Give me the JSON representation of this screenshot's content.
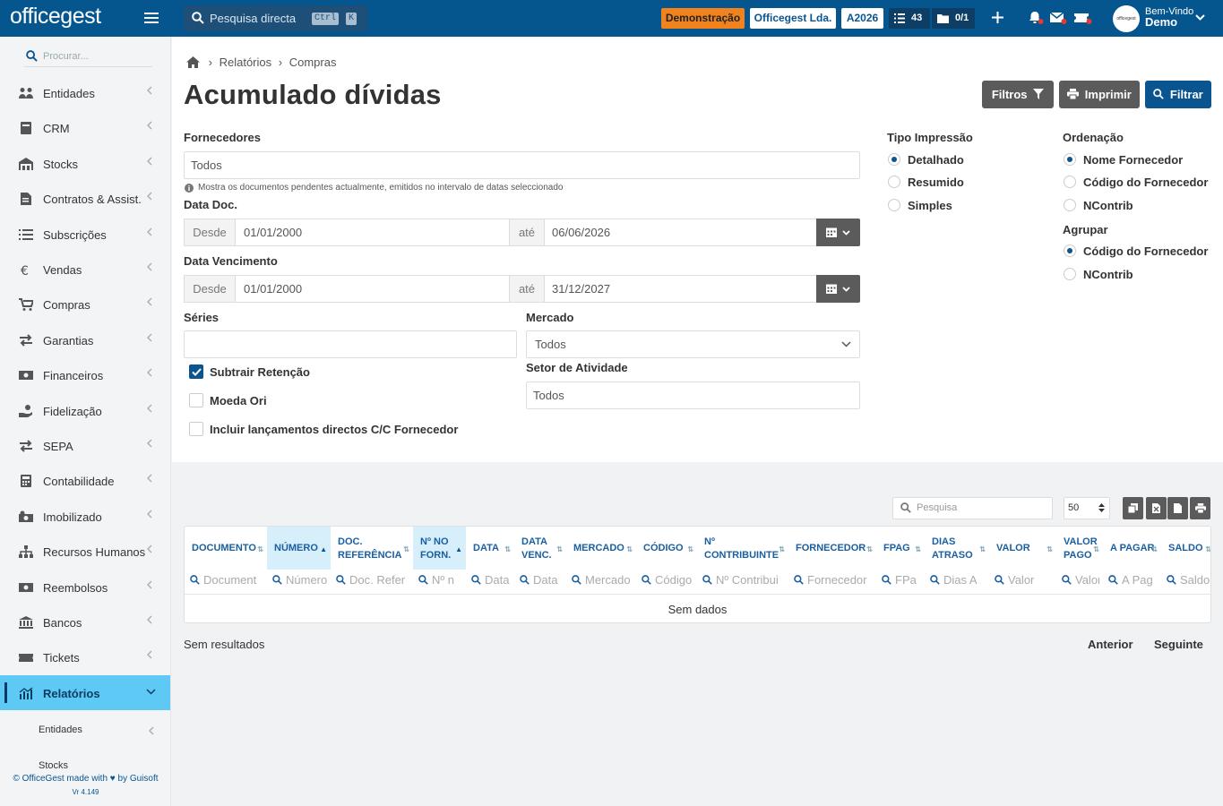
{
  "topbar": {
    "logo": "officegest",
    "search_placeholder": "Pesquisa directa",
    "kbd1": "Ctrl",
    "kbd2": "K",
    "demo": "Demonstração",
    "company": "Officegest Lda.",
    "year": "A2026",
    "tasks": "43",
    "docs": "0/1",
    "welcome": "Bem-Vindo",
    "user": "Demo",
    "avatar_text": "officegest"
  },
  "sidebar": {
    "search_placeholder": "Procurar...",
    "items": [
      {
        "label": "Entidades",
        "icon": "users-icon"
      },
      {
        "label": "CRM",
        "icon": "book-icon"
      },
      {
        "label": "Stocks",
        "icon": "warehouse-icon"
      },
      {
        "label": "Contratos & Assist.",
        "icon": "file-contract-icon"
      },
      {
        "label": "Subscrições",
        "icon": "list-icon"
      },
      {
        "label": "Vendas",
        "icon": "euro-icon"
      },
      {
        "label": "Compras",
        "icon": "cart-icon"
      },
      {
        "label": "Garantias",
        "icon": "exchange-icon"
      },
      {
        "label": "Financeiros",
        "icon": "money-icon"
      },
      {
        "label": "Fidelização",
        "icon": "hand-coin-icon"
      },
      {
        "label": "SEPA",
        "icon": "exchange-icon"
      },
      {
        "label": "Contabilidade",
        "icon": "calculator-icon"
      },
      {
        "label": "Imobilizado",
        "icon": "cogs-money-icon"
      },
      {
        "label": "Recursos Humanos",
        "icon": "sitemap-icon"
      },
      {
        "label": "Reembolsos",
        "icon": "money-icon"
      },
      {
        "label": "Bancos",
        "icon": "bank-icon"
      },
      {
        "label": "Tickets",
        "icon": "ticket-icon"
      },
      {
        "label": "Relatórios",
        "icon": "chart-icon"
      }
    ],
    "sub": [
      "Entidades",
      "Stocks"
    ],
    "footer": "© OfficeGest made with ♥ by Guisoft",
    "version": "Vr 4.149"
  },
  "breadcrumb": [
    "Relatórios",
    "Compras"
  ],
  "title": "Acumulado dívidas",
  "buttons": {
    "filtros": "Filtros",
    "imprimir": "Imprimir",
    "filtrar": "Filtrar"
  },
  "form": {
    "fornecedores_label": "Fornecedores",
    "fornecedores_value": "Todos",
    "hint": "Mostra os documentos pendentes actualmente, emitidos no intervalo de datas seleccionado",
    "data_doc_label": "Data Doc.",
    "desde": "Desde",
    "ate": "até",
    "data_doc_from": "01/01/2000",
    "data_doc_to": "06/06/2026",
    "data_venc_label": "Data Vencimento",
    "data_venc_from": "01/01/2000",
    "data_venc_to": "31/12/2027",
    "series_label": "Séries",
    "mercado_label": "Mercado",
    "mercado_value": "Todos",
    "setor_label": "Setor de Atividade",
    "setor_value": "Todos",
    "chk_subtrair": "Subtrair Retenção",
    "chk_moeda": "Moeda Ori",
    "chk_incluir": "Incluir lançamentos directos C/C Fornecedor",
    "tipo_label": "Tipo Impressão",
    "tipo_options": [
      "Detalhado",
      "Resumido",
      "Simples"
    ],
    "ordem_label": "Ordenação",
    "ordem_options": [
      "Nome Fornecedor",
      "Código do Fornecedor",
      "NContrib"
    ],
    "agrupar_label": "Agrupar",
    "agrupar_options": [
      "Código do Fornecedor",
      "NContrib"
    ]
  },
  "grid": {
    "search_placeholder": "Pesquisa",
    "page_size": "50",
    "columns": [
      {
        "h1": "DOCUMENTO",
        "h2": "",
        "f": "Document"
      },
      {
        "h1": "NÚMERO",
        "h2": "",
        "f": "Número"
      },
      {
        "h1": "DOC.",
        "h2": "REFERÊNCIA",
        "f": "Doc. Refer"
      },
      {
        "h1": "Nº NO",
        "h2": "FORN.",
        "f": "Nº n"
      },
      {
        "h1": "DATA",
        "h2": "",
        "f": "Data"
      },
      {
        "h1": "DATA",
        "h2": "VENC.",
        "f": "Data"
      },
      {
        "h1": "MERCADO",
        "h2": "",
        "f": "Mercado"
      },
      {
        "h1": "CÓDIGO",
        "h2": "",
        "f": "Código"
      },
      {
        "h1": "Nº",
        "h2": "CONTRIBUINTE",
        "f": "Nº Contribui"
      },
      {
        "h1": "FORNECEDOR",
        "h2": "",
        "f": "Fornecedor"
      },
      {
        "h1": "FPAG",
        "h2": "",
        "f": "FPa"
      },
      {
        "h1": "DIAS",
        "h2": "ATRASO",
        "f": "Dias A"
      },
      {
        "h1": "VALOR",
        "h2": "",
        "f": "Valor"
      },
      {
        "h1": "VALOR",
        "h2": "PAGO",
        "f": "Valor"
      },
      {
        "h1": "A PAGAR",
        "h2": "",
        "f": "A Pag"
      },
      {
        "h1": "SALDO",
        "h2": "",
        "f": "Saldo"
      }
    ],
    "no_data": "Sem dados",
    "no_results": "Sem resultados",
    "prev": "Anterior",
    "next": "Seguinte"
  },
  "colors": {
    "topbar": "#05568f",
    "accent": "#0a558f",
    "active": "#5ec9f4",
    "demo": "#f0831e"
  }
}
